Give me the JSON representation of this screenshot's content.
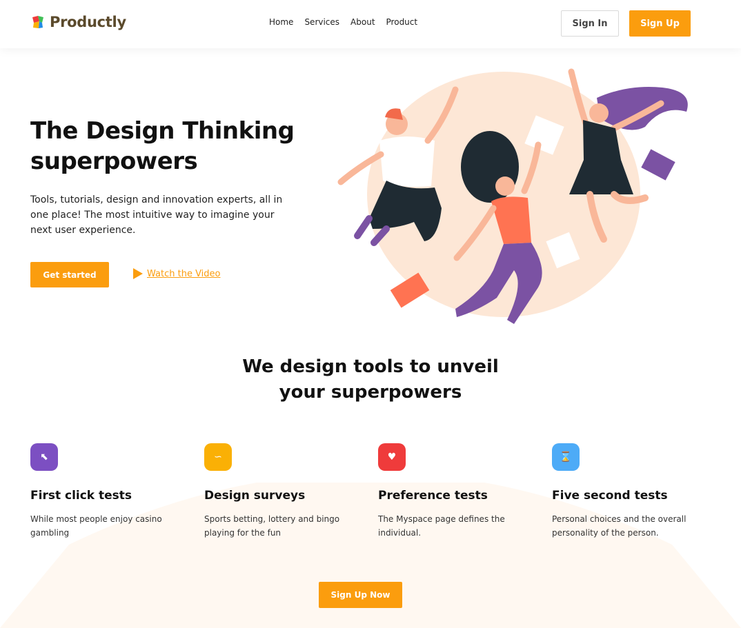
{
  "brand": {
    "name": "Productly"
  },
  "nav": {
    "items": [
      "Home",
      "Services",
      "About",
      "Product"
    ]
  },
  "header": {
    "signin_label": "Sign In",
    "signup_label": "Sign Up"
  },
  "hero": {
    "title_line1": "The Design Thinking",
    "title_line2": "superpowers",
    "description": "Tools, tutorials, design and innovation experts, all in one place! The most intuitive way to imagine your next user experience.",
    "cta_label": "Get started",
    "video_label": "Watch the Video"
  },
  "section": {
    "title_line1": "We design tools to unveil",
    "title_line2": "your superpowers"
  },
  "features": [
    {
      "icon": "cursor-icon",
      "color": "#7c4fc2",
      "title": "First click tests",
      "desc": "While most people enjoy casino gambling"
    },
    {
      "icon": "stumbleupon-icon",
      "color": "#fab005",
      "title": "Design surveys",
      "desc": "Sports betting, lottery and bingo playing for the fun"
    },
    {
      "icon": "heart-icon",
      "color": "#ef3b3b",
      "title": "Preference tests",
      "desc": "The Myspace page defines the individual."
    },
    {
      "icon": "hourglass-icon",
      "color": "#4dabf7",
      "title": "Five second tests",
      "desc": "Personal choices and the overall personality of the person."
    }
  ],
  "footer_cta": {
    "label": "Sign Up Now"
  },
  "colors": {
    "accent": "#fb9d0e",
    "peach": "#fde7d6"
  }
}
